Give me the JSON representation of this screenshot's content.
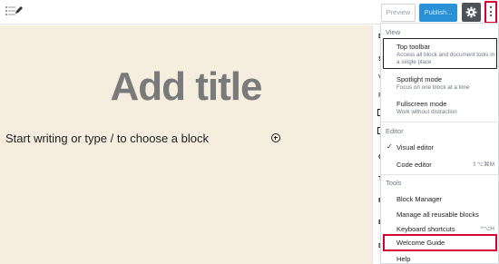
{
  "toolbar": {
    "preview_label": "Preview",
    "publish_label": "Publish...",
    "icons": [
      "block-navigation-icon",
      "edit-icon",
      "gear-icon",
      "more-vertical-icon"
    ]
  },
  "editor": {
    "title_placeholder": "Add title",
    "body_placeholder": "Start writing or type / to choose a block"
  },
  "sidebar": {
    "letters": [
      "D",
      "S",
      "V",
      "F",
      "",
      "",
      "C",
      "T",
      "F",
      "E",
      "D"
    ]
  },
  "menu": {
    "view_label": "View",
    "view_items": [
      {
        "label": "Top toolbar",
        "description": "Access all block and document tools in a single place"
      },
      {
        "label": "Spotlight mode",
        "description": "Focus on one block at a time"
      },
      {
        "label": "Fullscreen mode",
        "description": "Work without distraction"
      }
    ],
    "editor_label": "Editor",
    "editor_items": [
      {
        "label": "Visual editor",
        "checked": "✓",
        "shortcut": ""
      },
      {
        "label": "Code editor",
        "checked": "",
        "shortcut": "⇧⌥⌘M"
      }
    ],
    "tools_label": "Tools",
    "tools_items": [
      {
        "label": "Block Manager",
        "shortcut": ""
      },
      {
        "label": "Manage all reusable blocks",
        "shortcut": ""
      },
      {
        "label": "Keyboard shortcuts",
        "shortcut": "^⌥H"
      },
      {
        "label": "Welcome Guide",
        "shortcut": ""
      },
      {
        "label": "Help",
        "shortcut": ""
      }
    ]
  },
  "colors": {
    "highlight": "#d70033",
    "publish": "#2a91d7",
    "canvas": "#f5eedf"
  }
}
